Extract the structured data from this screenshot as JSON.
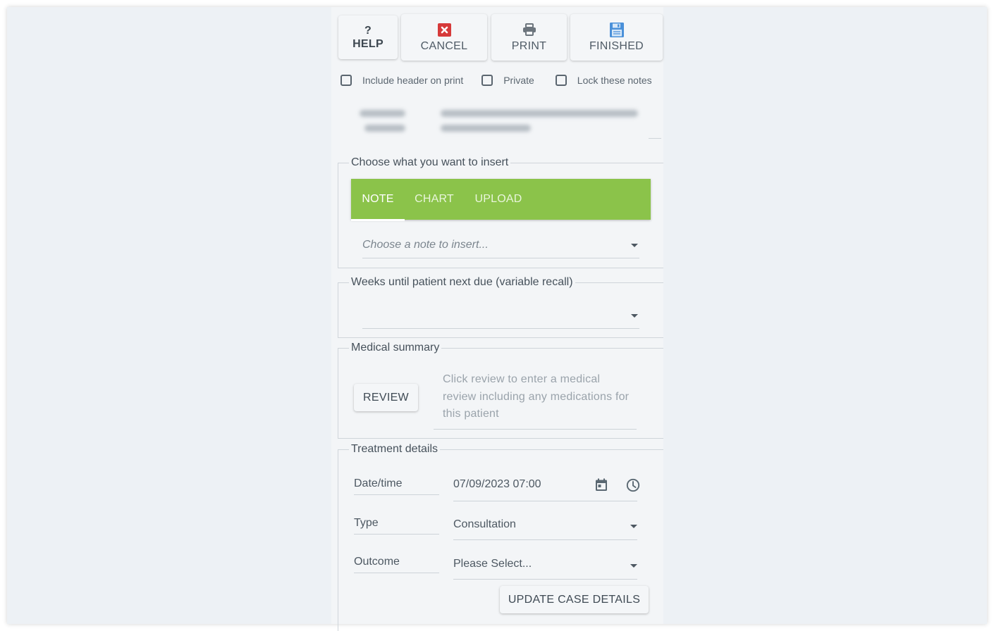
{
  "toolbar": {
    "help": {
      "label": "HELP",
      "icon": "?"
    },
    "cancel": {
      "label": "CANCEL",
      "icon": "close-icon",
      "icon_color": "#d63a3a"
    },
    "print": {
      "label": "PRINT",
      "icon": "printer-icon",
      "icon_color": "#6c757d"
    },
    "finished": {
      "label": "FINISHED",
      "icon": "save-icon",
      "icon_color": "#4a90d9"
    }
  },
  "options": {
    "include_header": {
      "label": "Include header on print",
      "checked": false
    },
    "private": {
      "label": "Private",
      "checked": false
    },
    "lock_notes": {
      "label": "Lock these notes",
      "checked": false
    }
  },
  "patient_header": {
    "redacted": true
  },
  "insert_section": {
    "legend": "Choose what you want to insert",
    "tabs": [
      {
        "label": "NOTE",
        "active": true
      },
      {
        "label": "CHART",
        "active": false
      },
      {
        "label": "UPLOAD",
        "active": false
      }
    ],
    "note_select": {
      "placeholder": "Choose a note to insert..."
    },
    "accent_color": "#8bc34a"
  },
  "recall_section": {
    "legend": "Weeks until patient next due (variable recall)",
    "value": ""
  },
  "medical_summary": {
    "legend": "Medical summary",
    "review_label": "REVIEW",
    "hint": "Click review to enter a medical review including any medications for this patient"
  },
  "treatment": {
    "legend": "Treatment details",
    "datetime": {
      "label": "Date/time",
      "value": "07/09/2023 07:00"
    },
    "type": {
      "label": "Type",
      "value": "Consultation"
    },
    "outcome": {
      "label": "Outcome",
      "value": "Please Select..."
    },
    "update_label": "UPDATE CASE DETAILS"
  }
}
